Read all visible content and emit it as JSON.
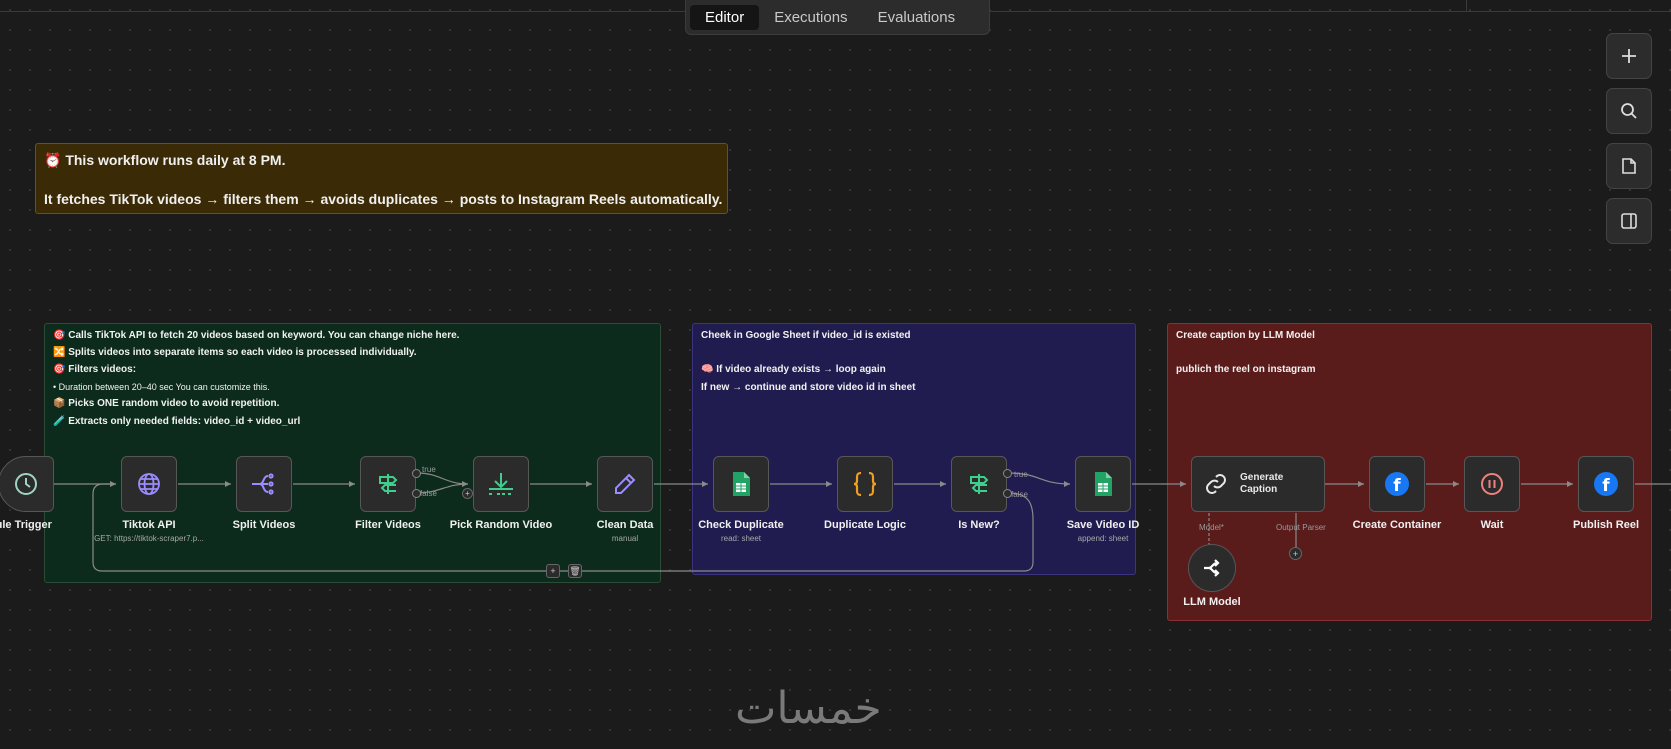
{
  "tabs": [
    {
      "label": "Editor",
      "active": true
    },
    {
      "label": "Executions",
      "active": false
    },
    {
      "label": "Evaluations",
      "active": false
    }
  ],
  "side_buttons": [
    "plus-icon",
    "search-icon",
    "sticky-note-icon",
    "panel-toggle-icon"
  ],
  "top_note": {
    "line1": "⏰ This workflow runs daily at 8 PM.",
    "line2": "It fetches TikTok videos → filters them → avoids duplicates → posts to Instagram Reels automatically."
  },
  "green_note": {
    "lines": [
      "🎯 Calls TikTok API to fetch 20 videos based on keyword. You can change niche here.",
      "🔀 Splits videos into separate items so each video is processed individually.",
      "🎯 Filters videos:",
      "• Duration between 20–40 sec You can customize this.",
      "📦 Picks ONE random video to avoid repetition.",
      "🧪 Extracts only needed fields: video_id + video_url"
    ]
  },
  "blue_note": {
    "lines": [
      "Cheek in Google Sheet if video_id is existed",
      "🧠 If video already exists → loop again",
      "If new → continue and store video id in sheet"
    ]
  },
  "red_note": {
    "lines": [
      "Create caption by LLM Model",
      "publich the reel on instagram"
    ]
  },
  "nodes": {
    "schedule": {
      "label": "hedule Trigger"
    },
    "tiktok": {
      "label": "Tiktok API",
      "sub": "GET: https://tiktok-scraper7.p..."
    },
    "split": {
      "label": "Split Videos"
    },
    "filter": {
      "label": "Filter Videos",
      "true_label": "true",
      "false_label": "false"
    },
    "pick": {
      "label": "Pick Random Video"
    },
    "clean": {
      "label": "Clean Data",
      "sub": "manual"
    },
    "check": {
      "label": "Check Duplicate",
      "sub": "read: sheet"
    },
    "logic": {
      "label": "Duplicate Logic"
    },
    "isnew": {
      "label": "Is New?",
      "true_label": "true",
      "false_label": "false"
    },
    "save": {
      "label": "Save Video ID",
      "sub": "append: sheet"
    },
    "caption": {
      "label1": "Generate",
      "label2": "Caption",
      "model_label": "Model*",
      "parser_label": "Output Parser"
    },
    "llm": {
      "label": "LLM Model"
    },
    "container": {
      "label": "Create Container"
    },
    "wait": {
      "label": "Wait"
    },
    "publish": {
      "label": "Publish Reel"
    }
  },
  "loop_controls": {
    "add": "+",
    "delete": "🗑"
  },
  "watermark": "خمسات",
  "colors": {
    "sheets_green": "#21a366",
    "logic_orange": "#f0a020",
    "facebook_blue": "#1877f2",
    "wait_pink": "#f08080",
    "purple_icon": "#9b8cff"
  }
}
